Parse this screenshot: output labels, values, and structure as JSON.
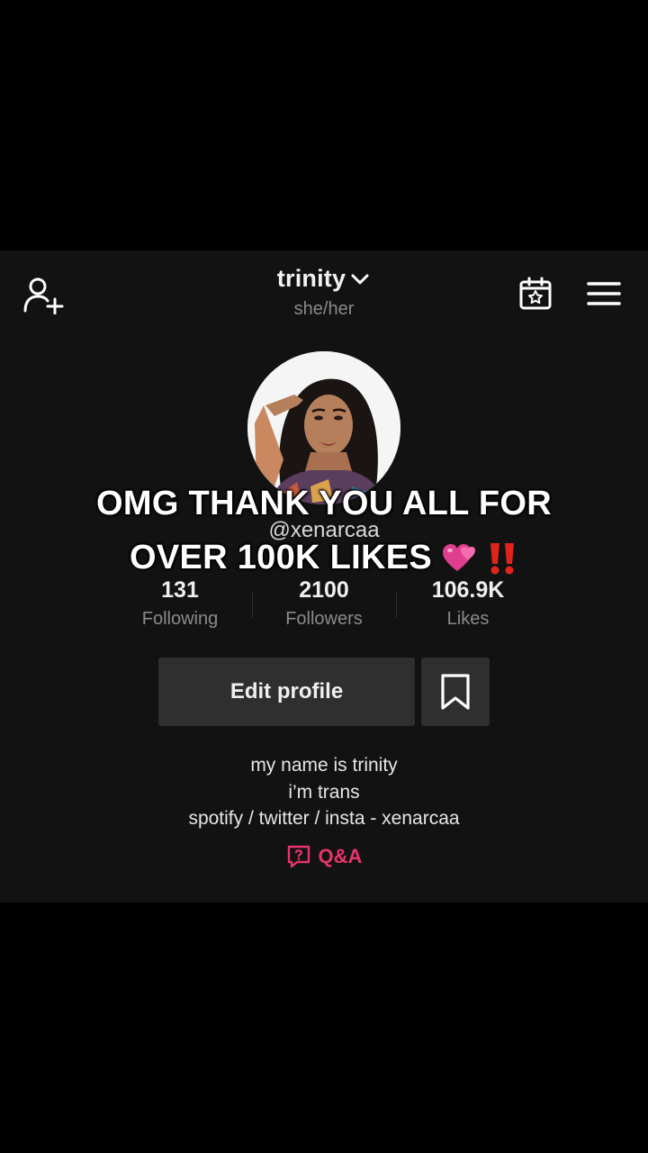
{
  "header": {
    "username": "trinity",
    "pronouns": "she/her",
    "icons": {
      "add_user": "add-user-icon",
      "calendar": "calendar-star-icon",
      "menu": "hamburger-menu-icon",
      "dropdown": "chevron-down-icon"
    }
  },
  "profile": {
    "handle": "@xenarcaa",
    "avatar": "avatar-photo"
  },
  "overlay": {
    "line1": "OMG THANK YOU ALL FOR",
    "line2": "OVER 100K LIKES"
  },
  "stats": [
    {
      "value": "131",
      "label": "Following"
    },
    {
      "value": "2100",
      "label": "Followers"
    },
    {
      "value": "106.9K",
      "label": "Likes"
    }
  ],
  "actions": {
    "edit_profile": "Edit profile",
    "bookmark": "bookmark-icon"
  },
  "bio": {
    "lines": [
      "my name is trinity",
      "i’m trans",
      "spotify / twitter / insta - xenarcaa"
    ]
  },
  "qa": {
    "label": "Q&A",
    "icon": "question-chat-icon"
  },
  "colors": {
    "background": "#000000",
    "panel": "#121212",
    "button": "#2f2f2f",
    "accent_pink": "#e8336b",
    "muted_text": "#8a8a8a"
  }
}
